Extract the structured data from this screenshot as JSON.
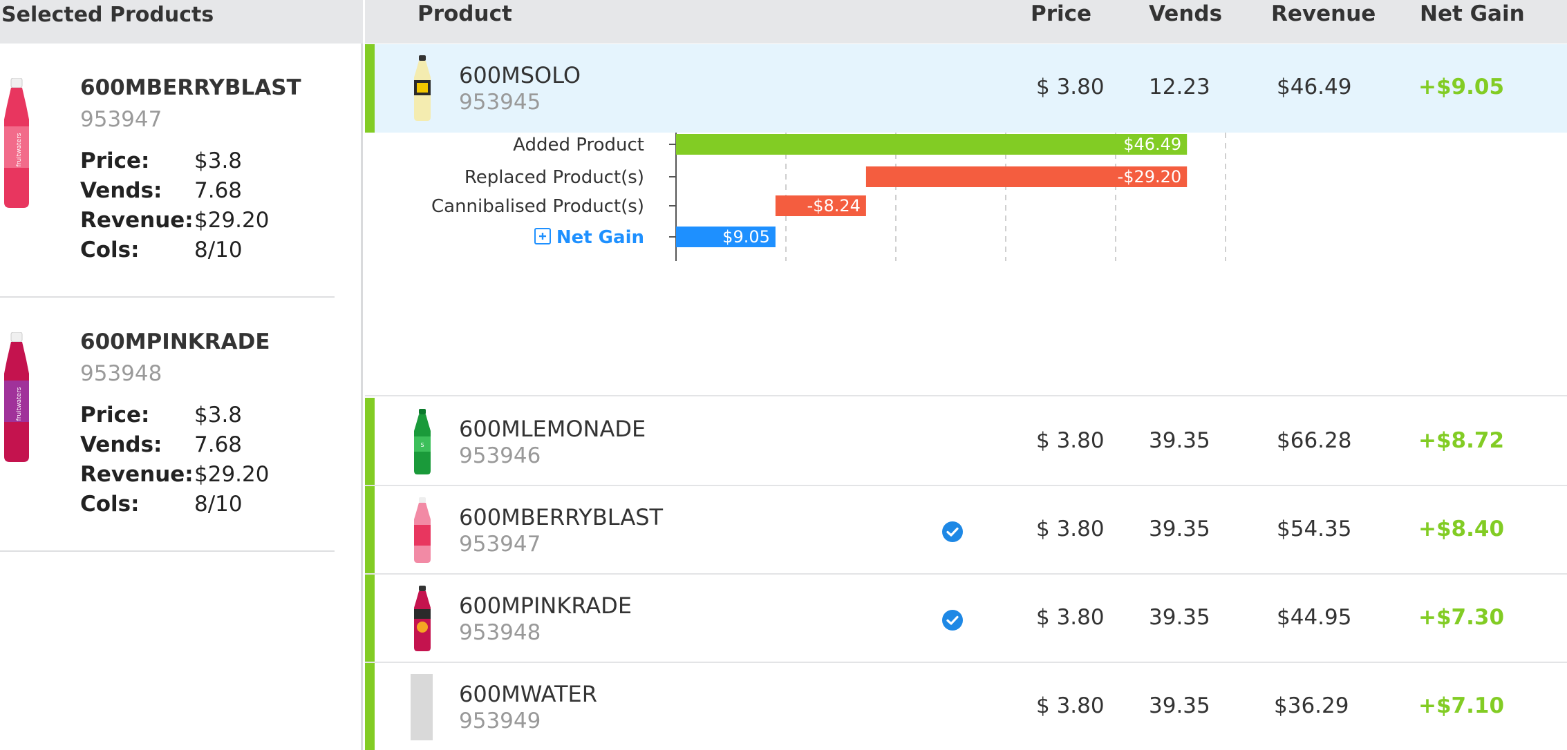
{
  "selected_panel": {
    "title": "Selected Products",
    "items": [
      {
        "name": "600MBERRYBLAST",
        "code": "953947",
        "price_label": "Price:",
        "price": "$3.8",
        "vends_label": "Vends:",
        "vends": "7.68",
        "revenue_label": "Revenue:",
        "revenue": "$29.20",
        "cols_label": "Cols:",
        "cols": "8/10",
        "color": "#e8365f"
      },
      {
        "name": "600MPINKRADE",
        "code": "953948",
        "price_label": "Price:",
        "price": "$3.8",
        "vends_label": "Vends:",
        "vends": "7.68",
        "revenue_label": "Revenue:",
        "revenue": "$29.20",
        "cols_label": "Cols:",
        "cols": "8/10",
        "color": "#c4134e"
      }
    ]
  },
  "table": {
    "headers": {
      "product": "Product",
      "price": "Price",
      "vends": "Vends",
      "revenue": "Revenue",
      "net_gain": "Net Gain"
    },
    "rows": [
      {
        "name": "600MSOLO",
        "code": "953945",
        "price": "$ 3.80",
        "vends": "12.23",
        "revenue": "$46.49",
        "net_gain": "+$9.05",
        "checked": false,
        "img_color": "#f0e36a"
      },
      {
        "name": "600MLEMONADE",
        "code": "953946",
        "price": "$ 3.80",
        "vends": "39.35",
        "revenue": "$66.28",
        "net_gain": "+$8.72",
        "checked": false,
        "img_color": "#1a9a3a"
      },
      {
        "name": "600MBERRYBLAST",
        "code": "953947",
        "price": "$ 3.80",
        "vends": "39.35",
        "revenue": "$54.35",
        "net_gain": "+$8.40",
        "checked": true,
        "img_color": "#e8365f"
      },
      {
        "name": "600MPINKRADE",
        "code": "953948",
        "price": "$ 3.80",
        "vends": "39.35",
        "revenue": "$44.95",
        "net_gain": "+$7.30",
        "checked": true,
        "img_color": "#c4134e"
      },
      {
        "name": "600MWATER",
        "code": "953949",
        "price": "$ 3.80",
        "vends": "39.35",
        "revenue": "$36.29",
        "net_gain": "+$7.10",
        "checked": false,
        "img_color": "#d9d9d9"
      }
    ]
  },
  "colors": {
    "accent": "#82cc24",
    "positive": "#82cc24",
    "negative": "#f45d3f",
    "net": "#1e90ff",
    "check": "#1e88e5",
    "active_row": "#e5f4fd"
  },
  "chart_data": {
    "type": "bar",
    "orientation": "horizontal-waterfall",
    "categories": [
      "Added Product",
      "Replaced Product(s)",
      "Cannibalised Product(s)",
      "Net Gain"
    ],
    "bars": [
      {
        "label": "Added Product",
        "start": 0,
        "end": 46.49,
        "value_label": "$46.49",
        "kind": "positive"
      },
      {
        "label": "Replaced Product(s)",
        "start": 17.29,
        "end": 46.49,
        "value_label": "-$29.20",
        "kind": "negative"
      },
      {
        "label": "Cannibalised Product(s)",
        "start": 9.05,
        "end": 17.29,
        "value_label": "-$8.24",
        "kind": "negative"
      },
      {
        "label": "Net Gain",
        "start": 0,
        "end": 9.05,
        "value_label": "$9.05",
        "kind": "net"
      }
    ],
    "x_ticks": [
      0,
      10,
      20,
      30,
      40,
      50
    ],
    "xlim": [
      0,
      50
    ],
    "grid": true,
    "expand_icon": "plus-square-icon"
  }
}
